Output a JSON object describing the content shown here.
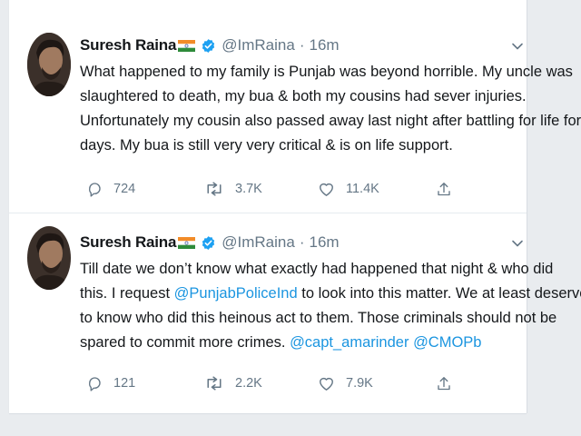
{
  "colors": {
    "accent": "#1da1f2",
    "text": "#14171a",
    "muted": "#657786",
    "link": "#1b95e0"
  },
  "tweets": [
    {
      "author": "Suresh Raina",
      "handle": "@ImRaina",
      "separator": "·",
      "time": "16m",
      "body_lines": [
        "What happened to my family is Punjab was beyond horrible. My uncle was",
        "slaughtered to death, my bua & both my cousins had sever injuries.",
        "Unfortunately my cousin also passed away last night after battling for life for",
        "days. My bua is still very very critical & is on life support."
      ],
      "stats": {
        "replies": "724",
        "retweets": "3.7K",
        "likes": "11.4K"
      }
    },
    {
      "author": "Suresh Raina",
      "handle": "@ImRaina",
      "separator": "·",
      "time": "16m",
      "body": {
        "l1": "Till date we don’t know what exactly had happened that night & who did",
        "l2a": "this. I request ",
        "l2_mention": "@PunjabPoliceInd",
        "l2b": " to look into this matter. We at least deserve",
        "l3": "to know who did this heinous act to them. Those criminals should not be",
        "l4a": "spared to commit more crimes. ",
        "l4_mention1": "@capt_amarinder",
        "l4_space": " ",
        "l4_mention2": "@CMOPb"
      },
      "stats": {
        "replies": "121",
        "retweets": "2.2K",
        "likes": "7.9K"
      }
    }
  ]
}
